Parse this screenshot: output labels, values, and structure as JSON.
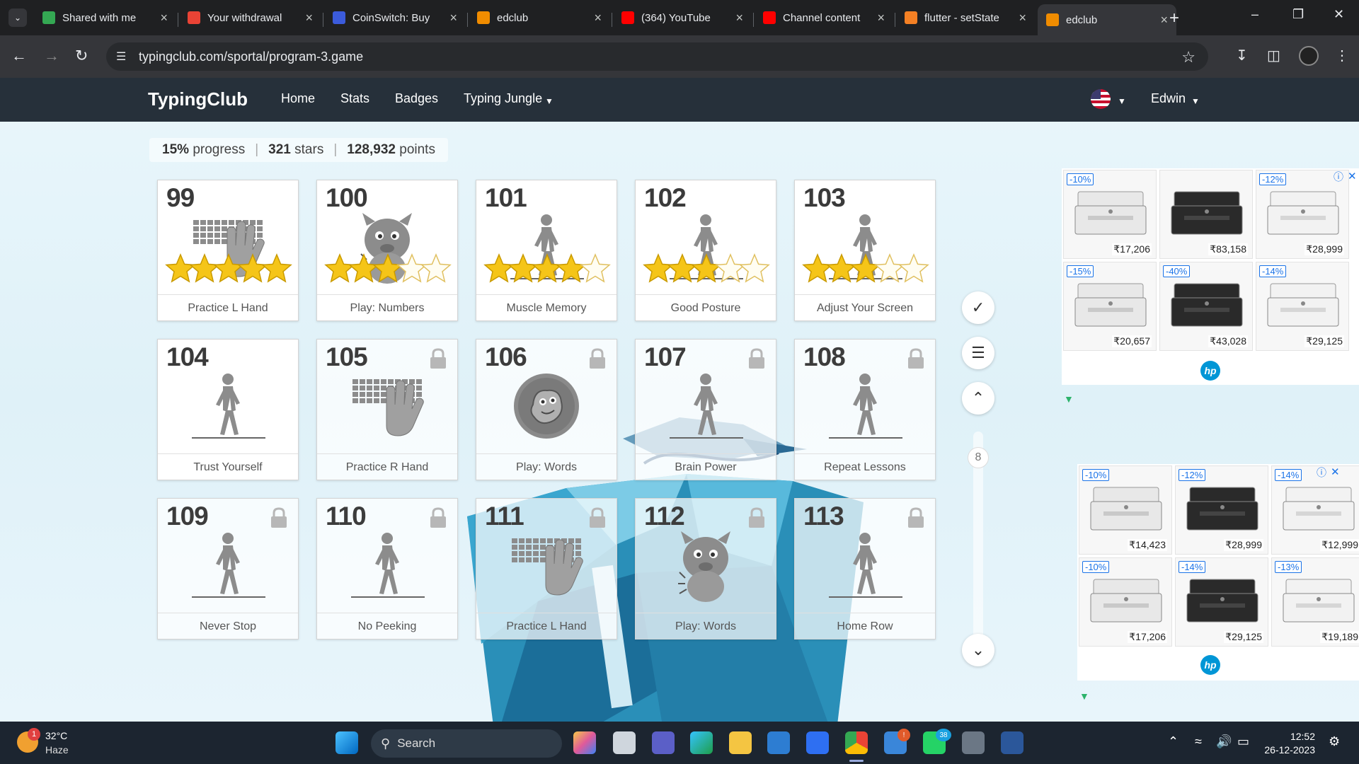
{
  "browser": {
    "tabs": [
      {
        "title": "Shared with me",
        "favicon": "google-drive-icon",
        "color": "#34a853"
      },
      {
        "title": "Your withdrawal",
        "favicon": "gmail-icon",
        "color": "#ea4335"
      },
      {
        "title": "CoinSwitch: Buy",
        "favicon": "coinswitch-icon",
        "color": "#3b5bdb"
      },
      {
        "title": "edclub",
        "favicon": "edclub-icon",
        "color": "#f08c00"
      },
      {
        "title": "(364) YouTube",
        "favicon": "youtube-icon",
        "color": "#ff0000"
      },
      {
        "title": "Channel content",
        "favicon": "youtube-studio-icon",
        "color": "#ff0000"
      },
      {
        "title": "flutter - setState",
        "favicon": "stackoverflow-icon",
        "color": "#f48024"
      },
      {
        "title": "edclub",
        "favicon": "edclub-icon",
        "color": "#f08c00",
        "active": true
      }
    ],
    "url": "typingclub.com/sportal/program-3.game"
  },
  "site": {
    "brand": "TypingClub",
    "nav": [
      "Home",
      "Stats",
      "Badges",
      "Typing Jungle"
    ],
    "user": "Edwin"
  },
  "progress": {
    "percent": "15%",
    "percent_label": "progress",
    "stars": "321",
    "stars_label": "stars",
    "points": "128,932",
    "points_label": "points"
  },
  "lessons": [
    {
      "num": "99",
      "label": "Practice L Hand",
      "art": "keyboard-hand",
      "stars": 5,
      "locked": false
    },
    {
      "num": "100",
      "label": "Play: Numbers",
      "art": "monster",
      "stars": 3,
      "locked": false
    },
    {
      "num": "101",
      "label": "Muscle Memory",
      "art": "walker",
      "stars": 4,
      "locked": false
    },
    {
      "num": "102",
      "label": "Good Posture",
      "art": "walker",
      "stars": 3,
      "locked": false
    },
    {
      "num": "103",
      "label": "Adjust Your Screen",
      "art": "walker",
      "stars": 3,
      "locked": false
    },
    {
      "num": "104",
      "label": "Trust Yourself",
      "art": "walker",
      "stars": 0,
      "locked": false
    },
    {
      "num": "105",
      "label": "Practice R Hand",
      "art": "keyboard-hand",
      "stars": 0,
      "locked": true
    },
    {
      "num": "106",
      "label": "Play: Words",
      "art": "game-circle",
      "stars": 0,
      "locked": true
    },
    {
      "num": "107",
      "label": "Brain Power",
      "art": "walker",
      "stars": 0,
      "locked": true
    },
    {
      "num": "108",
      "label": "Repeat Lessons",
      "art": "walker",
      "stars": 0,
      "locked": true
    },
    {
      "num": "109",
      "label": "Never Stop",
      "art": "walker",
      "stars": 0,
      "locked": true
    },
    {
      "num": "110",
      "label": "No Peeking",
      "art": "walker",
      "stars": 0,
      "locked": true
    },
    {
      "num": "111",
      "label": "Practice L Hand",
      "art": "keyboard-hand",
      "stars": 0,
      "locked": true
    },
    {
      "num": "112",
      "label": "Play: Words",
      "art": "monster",
      "stars": 0,
      "locked": true
    },
    {
      "num": "113",
      "label": "Home Row",
      "art": "walker",
      "stars": 0,
      "locked": true
    }
  ],
  "scroll_indicator": "8",
  "ads": {
    "top": [
      {
        "discount": "-10%",
        "price": "₹17,206"
      },
      {
        "discount": "",
        "price": "₹83,158"
      },
      {
        "discount": "-12%",
        "price": "₹28,999"
      },
      {
        "discount": "-15%",
        "price": "₹20,657"
      },
      {
        "discount": "-40%",
        "price": "₹43,028"
      },
      {
        "discount": "-14%",
        "price": "₹29,125"
      }
    ],
    "bottom": [
      {
        "discount": "-10%",
        "price": "₹14,423"
      },
      {
        "discount": "-12%",
        "price": "₹28,999"
      },
      {
        "discount": "-14%",
        "price": "₹12,999"
      },
      {
        "discount": "-10%",
        "price": "₹17,206"
      },
      {
        "discount": "-14%",
        "price": "₹29,125"
      },
      {
        "discount": "-13%",
        "price": "₹19,189"
      }
    ],
    "brand_logo": "hp"
  },
  "taskbar": {
    "weather_temp": "32°C",
    "weather_desc": "Haze",
    "weather_badge": "1",
    "search_label": "Search",
    "time": "12:52",
    "date": "26-12-2023",
    "teams_badge": "!",
    "whatsapp_badge": "38"
  }
}
